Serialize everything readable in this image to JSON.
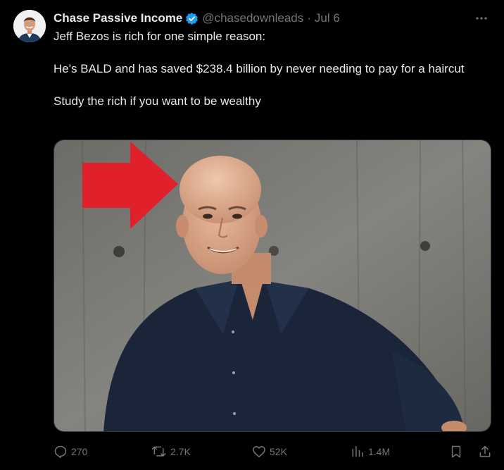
{
  "author": {
    "display_name": "Chase Passive Income",
    "handle": "@chasedownleads",
    "separator": "·",
    "date": "Jul 6",
    "verified_icon": "verified-badge-icon"
  },
  "tweet": {
    "lines": [
      "Jeff Bezos is rich for one simple reason:",
      "He's BALD and has saved $238.4 billion by never needing to pay for a haircut",
      "Study the rich if you want to be wealthy"
    ]
  },
  "actions": {
    "replies": "270",
    "retweets": "2.7K",
    "likes": "52K",
    "views": "1.4M"
  },
  "colors": {
    "background": "#000000",
    "text": "#e7e9ea",
    "secondary": "#71767b",
    "verified": "#1d9bf0",
    "arrow": "#e0202a"
  }
}
